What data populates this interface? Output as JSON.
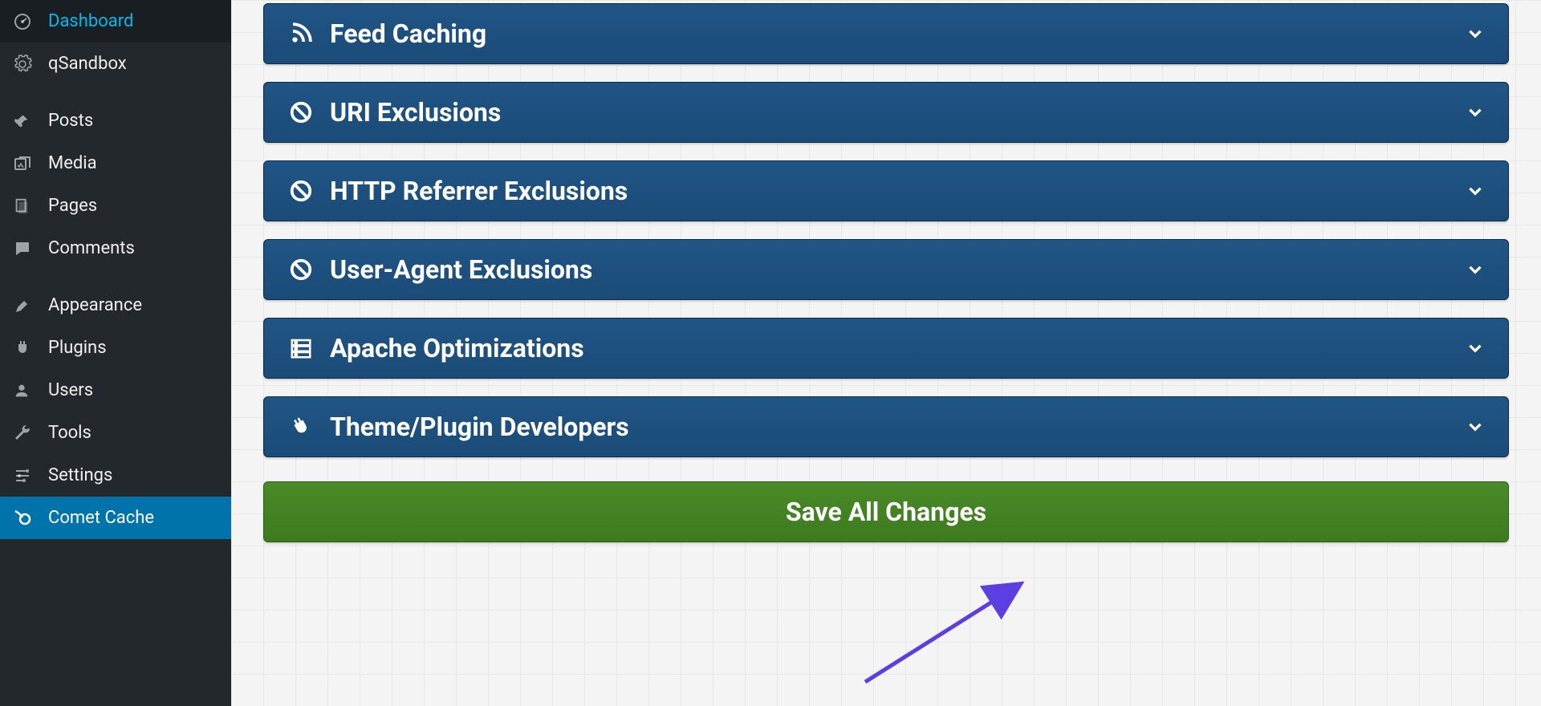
{
  "sidebar": {
    "items": [
      {
        "label": "Dashboard"
      },
      {
        "label": "qSandbox"
      },
      {
        "label": "Posts"
      },
      {
        "label": "Media"
      },
      {
        "label": "Pages"
      },
      {
        "label": "Comments"
      },
      {
        "label": "Appearance"
      },
      {
        "label": "Plugins"
      },
      {
        "label": "Users"
      },
      {
        "label": "Tools"
      },
      {
        "label": "Settings"
      },
      {
        "label": "Comet Cache"
      }
    ]
  },
  "panels": [
    {
      "label": "Feed Caching"
    },
    {
      "label": "URI Exclusions"
    },
    {
      "label": "HTTP Referrer Exclusions"
    },
    {
      "label": "User-Agent Exclusions"
    },
    {
      "label": "Apache Optimizations"
    },
    {
      "label": "Theme/Plugin Developers"
    }
  ],
  "save_label": "Save All Changes"
}
